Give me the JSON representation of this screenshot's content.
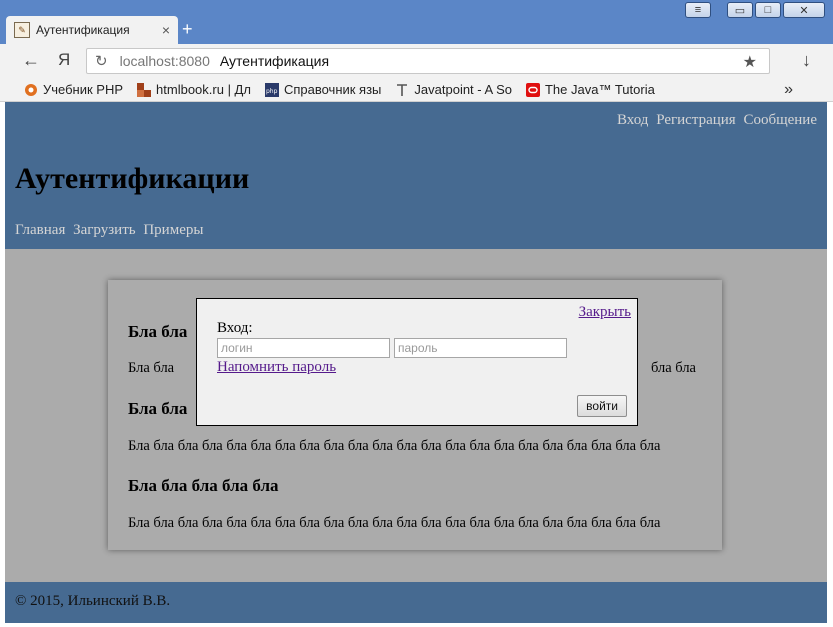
{
  "browser": {
    "tab_title": "Аутентификация",
    "tab_close": "×",
    "new_tab": "+",
    "url_host": "localhost:8080",
    "url_page_title": "Аутентификация",
    "yandex": "Я",
    "back": "←",
    "reload": "↻",
    "star": "★",
    "download": "↓",
    "more": "»",
    "bookmarks": [
      {
        "label": "Учебник PHP",
        "icon": "php-tutorial-icon",
        "color": "#e07020"
      },
      {
        "label": "htmlbook.ru | Дл",
        "icon": "htmlbook-icon",
        "color": "#a0401a"
      },
      {
        "label": "Справочник язы",
        "icon": "php-icon",
        "color": "#2a3a6a"
      },
      {
        "label": "Javatpoint - A So",
        "icon": "text-t-icon",
        "color": "#555555"
      },
      {
        "label": "The Java™ Tutoria",
        "icon": "oracle-icon",
        "color": "#e01010"
      }
    ],
    "window_buttons": {
      "minimize": "▭",
      "maximize": "□",
      "close": "✕",
      "menu": "≡"
    }
  },
  "page": {
    "top_nav": [
      "Вход",
      "Регистрация",
      "Сообщение"
    ],
    "title": "Аутентификации",
    "main_nav": [
      "Главная",
      "Загрузить",
      "Примеры"
    ],
    "sections": [
      {
        "heading": "Бла бла",
        "text": "Бла бла",
        "text_end": "бла бла"
      },
      {
        "heading": "Бла бла",
        "text": "Бла бла бла бла бла бла бла бла бла бла бла бла бла бла бла бла бла бла бла бла бла бла"
      },
      {
        "heading": "Бла бла бла бла бла",
        "text": "Бла бла бла бла бла бла бла бла бла бла бла бла бла бла бла бла бла бла бла бла бла бла"
      }
    ],
    "footer": "© 2015, Ильинский В.В."
  },
  "modal": {
    "close": "Закрыть",
    "login_label": "Вход:",
    "login_placeholder": "логин",
    "password_placeholder": "пароль",
    "remind": "Напомнить пароль",
    "submit": "войти"
  },
  "colors": {
    "header_bg": "#466a91",
    "page_bg": "#ababab",
    "modal_bg": "#f0f0f0",
    "link_visited": "#551a8b"
  }
}
